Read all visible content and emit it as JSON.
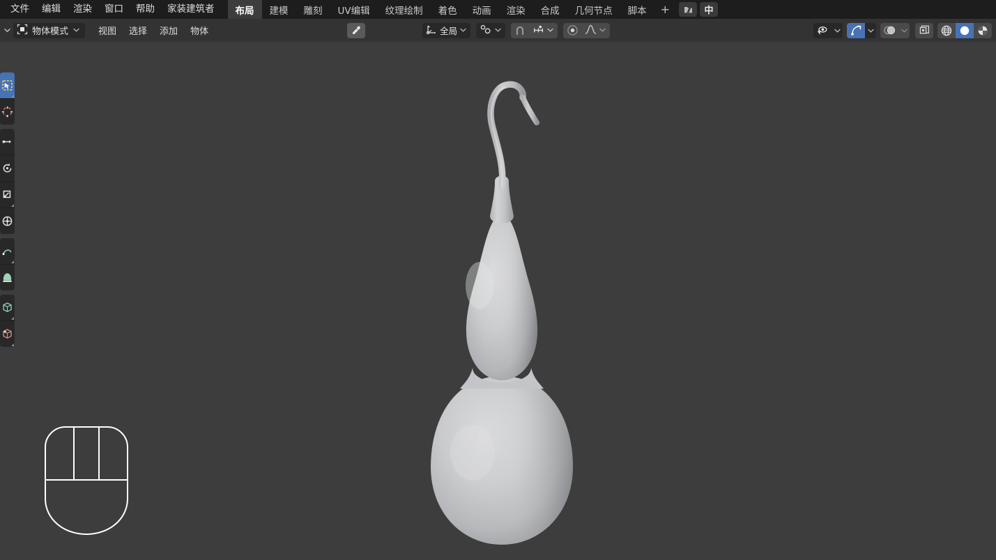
{
  "app": {
    "name": "Blender",
    "locale": "zh-CN",
    "background_color": "#3d3d3d",
    "topbar_color": "#1d1d1d",
    "header_color": "#333333",
    "accent_color": "#4772b3"
  },
  "topbar": {
    "menus": [
      {
        "label": "文件",
        "name": "menu-file"
      },
      {
        "label": "编辑",
        "name": "menu-edit"
      },
      {
        "label": "渲染",
        "name": "menu-render"
      },
      {
        "label": "窗口",
        "name": "menu-window"
      },
      {
        "label": "帮助",
        "name": "menu-help"
      },
      {
        "label": "家装建筑者",
        "name": "menu-archipack"
      }
    ],
    "workspaces": [
      {
        "label": "布局",
        "active": true
      },
      {
        "label": "建模",
        "active": false
      },
      {
        "label": "雕刻",
        "active": false
      },
      {
        "label": "UV编辑",
        "active": false
      },
      {
        "label": "纹理绘制",
        "active": false
      },
      {
        "label": "着色",
        "active": false
      },
      {
        "label": "动画",
        "active": false
      },
      {
        "label": "渲染",
        "active": false
      },
      {
        "label": "合成",
        "active": false
      },
      {
        "label": "几何节点",
        "active": false
      },
      {
        "label": "脚本",
        "active": false
      }
    ],
    "add_workspace_label": "+",
    "scene_icon": "scene-collection-icon",
    "ime_label": "中"
  },
  "header": {
    "editor_type_icon": "editor-type-chevron-icon",
    "mode": {
      "icon": "object-mode-icon",
      "label": "物体模式"
    },
    "menus": [
      {
        "label": "视图",
        "name": "view-menu"
      },
      {
        "label": "选择",
        "name": "select-menu"
      },
      {
        "label": "添加",
        "name": "add-menu"
      },
      {
        "label": "物体",
        "name": "object-menu"
      }
    ],
    "eyedropper_icon": "eyedropper-icon",
    "transform_orientation": {
      "icon": "transform-orientation-icon",
      "label": "全局"
    },
    "pivot_point": {
      "icon": "pivot-point-icon"
    },
    "snap": {
      "magnet_icon": "magnet-icon",
      "snap_to_icon": "snap-increment-icon",
      "enabled": false
    },
    "proportional_editing": {
      "icon": "proportional-edit-icon",
      "falloff_icon": "falloff-curve-icon",
      "enabled": false
    },
    "right": {
      "visibility_icon": "object-visibility-icon",
      "gizmo_icon": "gizmo-icon",
      "gizmo_on": true,
      "overlays_icon": "overlays-icon",
      "overlays_on": false,
      "xray_icon": "xray-toggle-icon",
      "shading": [
        {
          "icon": "shading-wireframe-icon",
          "active": false
        },
        {
          "icon": "shading-solid-icon",
          "active": true
        },
        {
          "icon": "shading-material-preview-icon",
          "active": false
        }
      ]
    }
  },
  "select_mode": {
    "buttons": [
      {
        "icon": "select-set-icon",
        "active": true
      },
      {
        "icon": "select-extend-icon",
        "active": false
      },
      {
        "icon": "select-subtract-icon",
        "active": false
      },
      {
        "icon": "select-intersect-icon",
        "active": false
      }
    ]
  },
  "toolbar": {
    "groups": [
      {
        "tools": [
          {
            "icon": "select-box-icon",
            "name": "tool-select-box",
            "active": true,
            "has_submenu": true
          },
          {
            "icon": "cursor-3d-icon",
            "name": "tool-cursor",
            "active": false,
            "has_submenu": false
          }
        ]
      },
      {
        "tools": [
          {
            "icon": "move-icon",
            "name": "tool-move",
            "active": false,
            "has_submenu": false
          },
          {
            "icon": "rotate-icon",
            "name": "tool-rotate",
            "active": false,
            "has_submenu": false
          },
          {
            "icon": "scale-icon",
            "name": "tool-scale",
            "active": false,
            "has_submenu": true
          },
          {
            "icon": "transform-icon",
            "name": "tool-transform",
            "active": false,
            "has_submenu": false
          }
        ]
      },
      {
        "tools": [
          {
            "icon": "annotate-icon",
            "name": "tool-annotate",
            "active": false,
            "has_submenu": true
          },
          {
            "icon": "measure-icon",
            "name": "tool-measure",
            "active": false,
            "has_submenu": false
          }
        ]
      },
      {
        "tools": [
          {
            "icon": "add-cube-icon",
            "name": "tool-add-cube",
            "active": false,
            "has_submenu": true
          },
          {
            "icon": "edit-cube-icon",
            "name": "tool-edit-cube",
            "active": false,
            "has_submenu": true
          }
        ]
      }
    ]
  },
  "viewport": {
    "model": {
      "name": "gourd-calabash-model",
      "description": "葫芦",
      "base_color": "#c8c9cb",
      "shadow_color": "#8b8c8f"
    },
    "mouse_overlay": {
      "name": "mouse-gizmo-overlay",
      "stroke_color": "#ffffff"
    }
  }
}
